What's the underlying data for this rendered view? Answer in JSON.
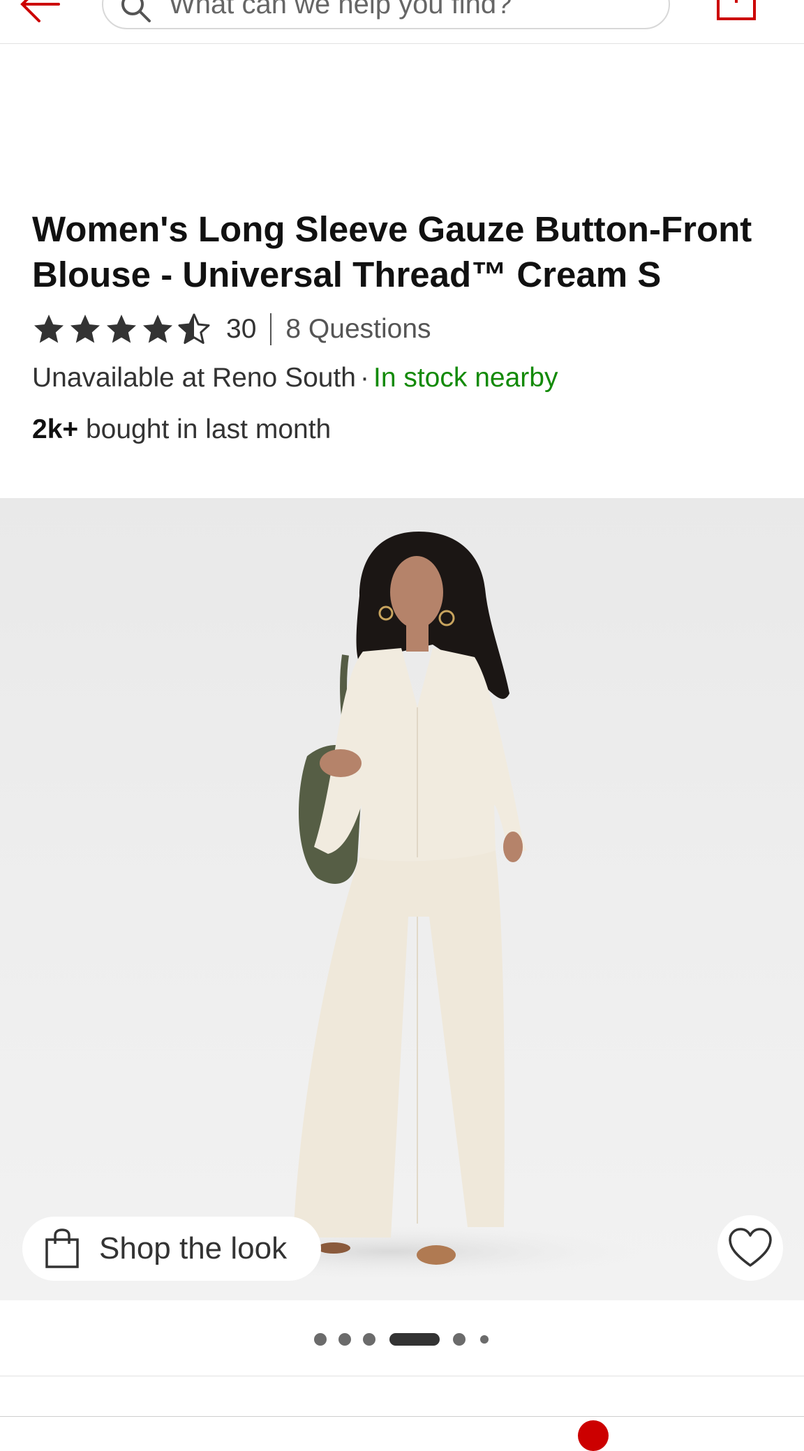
{
  "search": {
    "placeholder": "What can we help you find?"
  },
  "product": {
    "title": "Women's Long Sleeve Gauze Button-Front Blouse - Universal Thread™ Cream S",
    "rating": 4.5,
    "rating_max": 5,
    "rating_count": "30",
    "questions": "8 Questions",
    "availability_store": "Unavailable at Reno South",
    "availability_separator": "·",
    "availability_nearby": "In stock nearby",
    "bought_count": "2k+",
    "bought_text": " bought in last month"
  },
  "image_overlay": {
    "shop_look_label": "Shop the look"
  },
  "carousel": {
    "count": 6,
    "active_index": 3
  },
  "colors": {
    "brand_red": "#cc0000",
    "in_stock_green": "#138a08",
    "text_dark": "#111111"
  }
}
